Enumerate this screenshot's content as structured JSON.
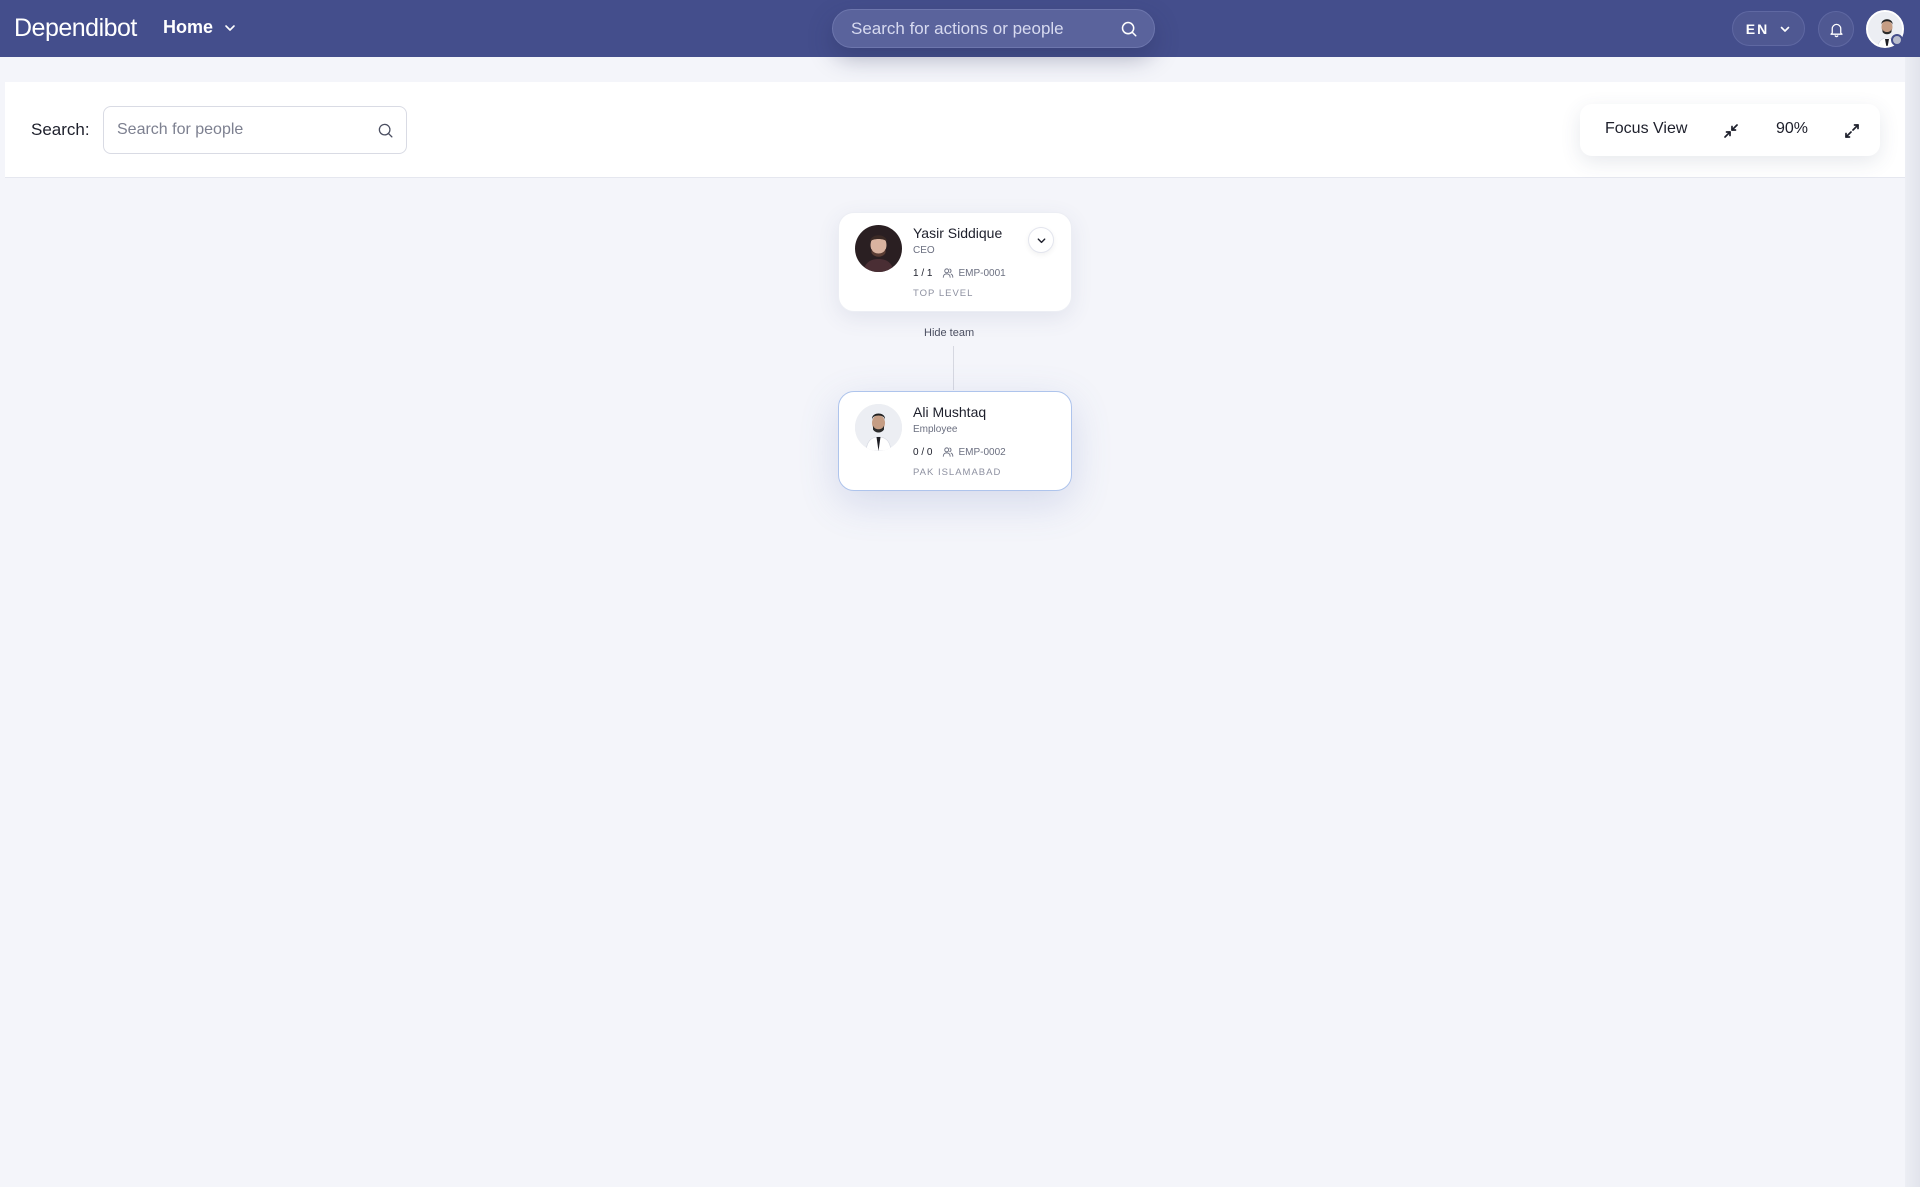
{
  "app": {
    "brand": "Dependibot",
    "nav_label": "Home"
  },
  "header": {
    "search_placeholder": "Search for actions or people",
    "language": "EN"
  },
  "toolbar": {
    "search_label": "Search:",
    "people_search_placeholder": "Search for people",
    "focus_view_label": "Focus View",
    "zoom": "90%"
  },
  "org_chart": {
    "hide_team_label": "Hide team",
    "nodes": [
      {
        "name": "Yasir Siddique",
        "role": "CEO",
        "count": "1 / 1",
        "emp_id": "EMP-0001",
        "location": "TOP LEVEL"
      },
      {
        "name": "Ali Mushtaq",
        "role": "Employee",
        "count": "0 / 0",
        "emp_id": "EMP-0002",
        "location": "PAK ISLAMABAD"
      }
    ]
  },
  "colors": {
    "header_bg": "#444e8c",
    "canvas_bg": "#f4f5fa",
    "highlight_border": "#aec4ec"
  }
}
